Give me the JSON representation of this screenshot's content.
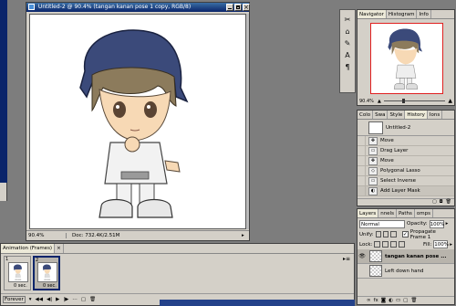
{
  "document": {
    "title": "Untitled-2 @ 90.4% (tangan kanan pose 1 copy, RGB/8)",
    "zoom": "90.4%",
    "doc_info": "Doc: 732.4K/2.51M"
  },
  "navigator": {
    "tabs": [
      "Navigator",
      "Histogram",
      "Info"
    ],
    "zoom": "90.4%"
  },
  "history": {
    "tabs": [
      "Colo",
      "Swa",
      "Style",
      "History",
      "Ions"
    ],
    "snapshot_label": "Untitled-2",
    "items": [
      "Move",
      "Drag Layer",
      "Move",
      "Polygonal Lasso",
      "Select Inverse",
      "Add Layer Mask"
    ]
  },
  "layers": {
    "tabs": [
      "Layers",
      "nnels",
      "Paths",
      "omps"
    ],
    "blend_mode": "Normal",
    "opacity_label": "Opacity:",
    "opacity_value": "100%",
    "unify_label": "Unify:",
    "propagate_label": "Propagate Frame 1",
    "lock_label": "Lock:",
    "fill_label": "Fill:",
    "fill_value": "100%",
    "items": [
      {
        "name": "tangan kanan pose ...",
        "selected": true
      },
      {
        "name": "Left down hand",
        "selected": false
      }
    ]
  },
  "animation": {
    "title": "Animation (Frames)",
    "frames": [
      {
        "number": "1",
        "delay": "0 sec."
      },
      {
        "number": "2",
        "delay": "0 sec."
      }
    ],
    "loop": "Forever"
  },
  "colors": {
    "bandana": "#3b4a7a",
    "hair": "#8c7b5c",
    "skin": "#f7d9b5",
    "titlebar": "#0a246a"
  }
}
